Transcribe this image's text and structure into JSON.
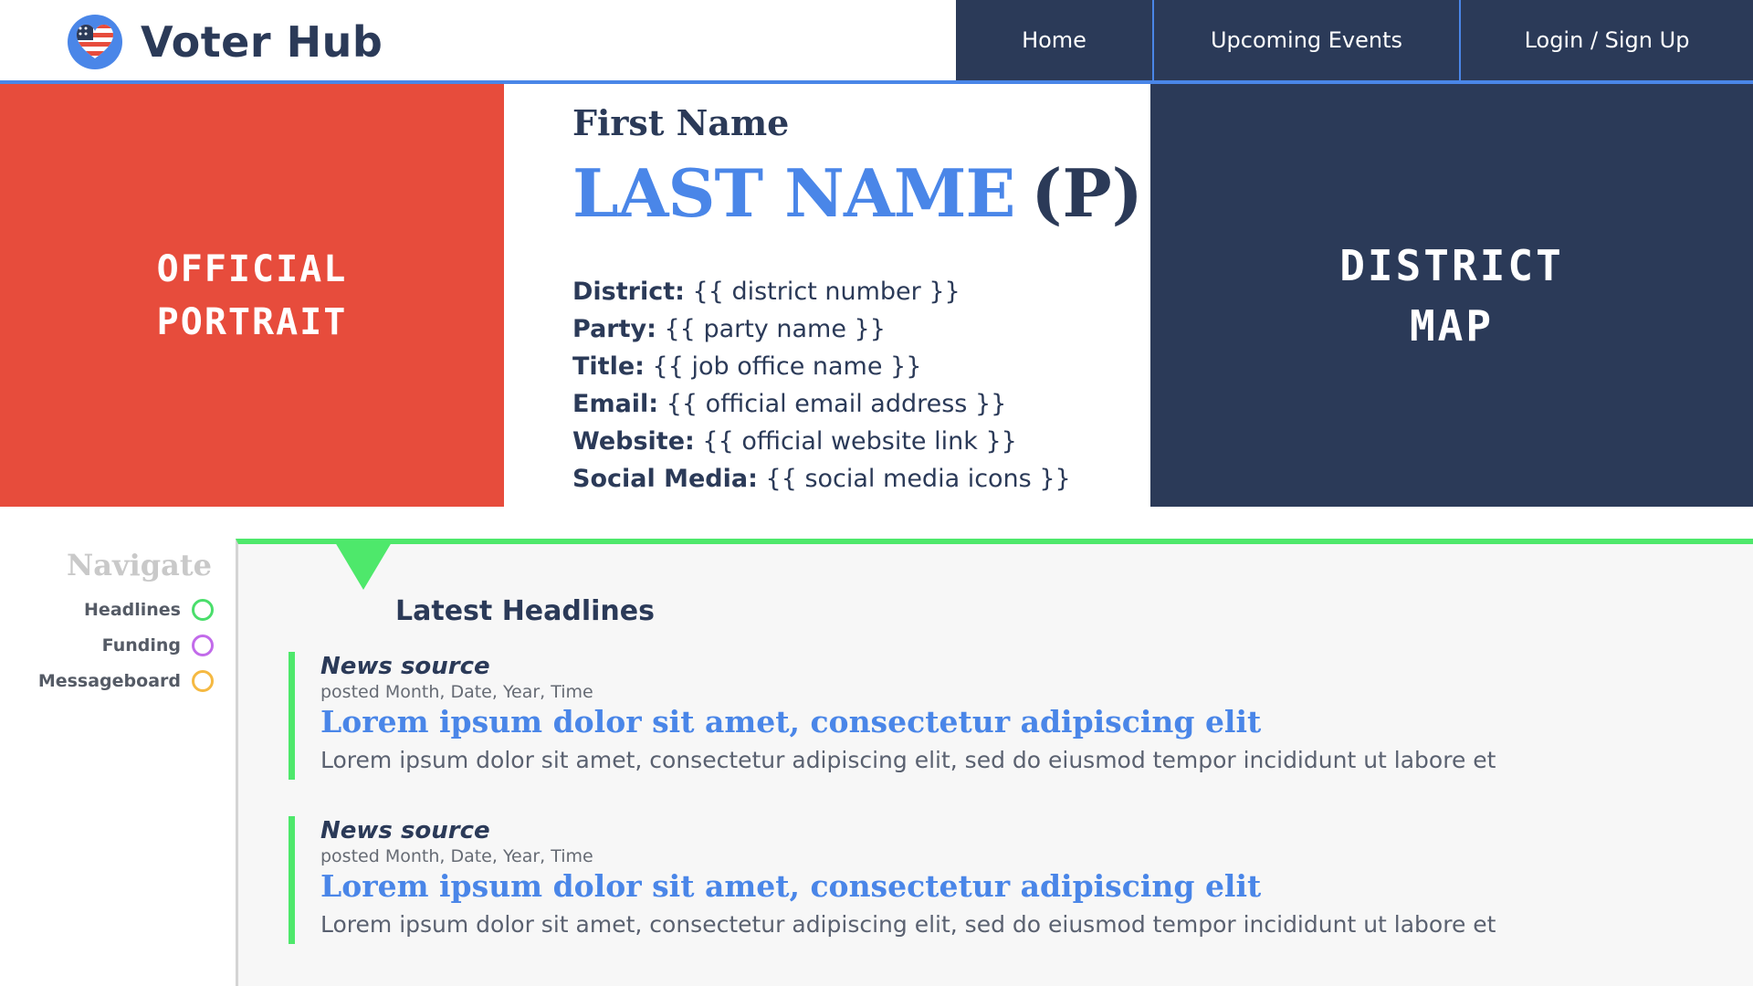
{
  "header": {
    "brand_name": "Voter Hub",
    "brand_icon": "heart-flag-icon",
    "nav": [
      {
        "label": "Home"
      },
      {
        "label": "Upcoming Events"
      },
      {
        "label": "Login / Sign Up"
      }
    ]
  },
  "hero": {
    "portrait_placeholder": "OFFICIAL\nPORTRAIT",
    "first_name": "First Name",
    "last_name": "LAST NAME",
    "party_letter": "(P)",
    "details": [
      {
        "label": "District:",
        "value": "{{ district number }}"
      },
      {
        "label": "Party:",
        "value": "{{ party name }}"
      },
      {
        "label": "Title:",
        "value": "{{ job office name }}"
      },
      {
        "label": "Email:",
        "value": "{{ official email address }}"
      },
      {
        "label": "Website:",
        "value": "{{ official website link }}"
      },
      {
        "label": "Social Media:",
        "value": "{{ social media icons }}"
      }
    ],
    "map_placeholder": "DISTRICT\nMAP"
  },
  "sidebar": {
    "title": "Navigate",
    "items": [
      {
        "label": "Headlines",
        "ring_color": "#4ade6b"
      },
      {
        "label": "Funding",
        "ring_color": "#c26bea"
      },
      {
        "label": "Messageboard",
        "ring_color": "#f5b942"
      }
    ]
  },
  "headlines": {
    "title": "Latest Headlines",
    "articles": [
      {
        "source": "News source",
        "posted": "posted Month, Date, Year, Time",
        "title": "Lorem ipsum dolor sit amet, consectetur adipiscing elit",
        "summary": "Lorem ipsum dolor sit amet, consectetur adipiscing elit, sed do eiusmod tempor incididunt ut labore et"
      },
      {
        "source": "News source",
        "posted": "posted Month, Date, Year, Time",
        "title": "Lorem ipsum dolor sit amet, consectetur adipiscing elit",
        "summary": "Lorem ipsum dolor sit amet, consectetur adipiscing elit, sed do eiusmod tempor incididunt ut labore et"
      }
    ]
  },
  "colors": {
    "navy": "#2b3a58",
    "blue": "#4a86e8",
    "red": "#e74c3c",
    "green": "#4ee86b",
    "purple": "#c26bea",
    "orange": "#f5b942"
  }
}
